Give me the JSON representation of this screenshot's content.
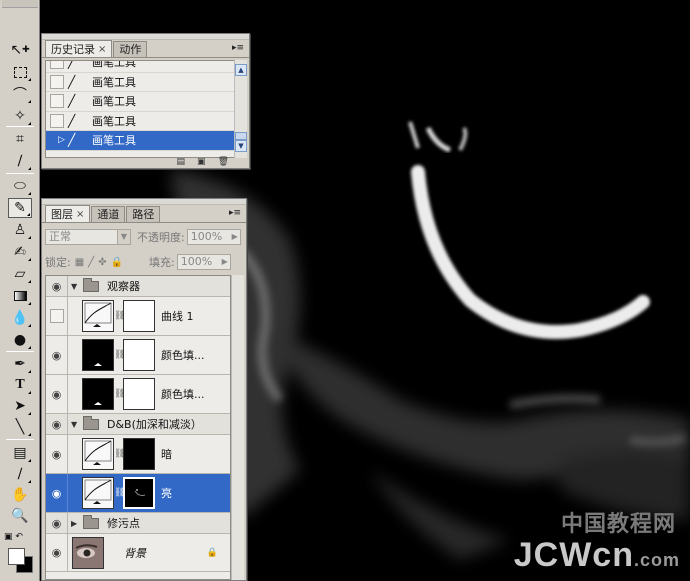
{
  "history_panel": {
    "tabs": [
      {
        "label": "历史记录",
        "active": true,
        "closable": true
      },
      {
        "label": "动作",
        "active": false,
        "closable": false
      }
    ],
    "items": [
      {
        "label": "画笔工具",
        "selected": false
      },
      {
        "label": "画笔工具",
        "selected": false
      },
      {
        "label": "画笔工具",
        "selected": false
      },
      {
        "label": "画笔工具",
        "selected": false
      },
      {
        "label": "画笔工具",
        "selected": true
      }
    ],
    "bottom_icons": [
      "new-document-from-state-icon",
      "snapshot-camera-icon",
      "trash-icon"
    ]
  },
  "layers_panel": {
    "tabs": [
      {
        "label": "图层",
        "active": true,
        "closable": true
      },
      {
        "label": "通道",
        "active": false,
        "closable": false
      },
      {
        "label": "路径",
        "active": false,
        "closable": false
      }
    ],
    "blend_mode": "正常",
    "opacity_label": "不透明度:",
    "opacity_value": "100%",
    "lock_label": "锁定:",
    "fill_label": "填充:",
    "fill_value": "100%",
    "rows": [
      {
        "kind": "group",
        "name": "观察器",
        "expanded": true,
        "visible": true
      },
      {
        "kind": "layer",
        "name": "曲线 1",
        "thumb": "curves",
        "mask": "white",
        "visible": false,
        "indent": true
      },
      {
        "kind": "layer",
        "name": "颜色填...",
        "thumb": "black",
        "mask": "white",
        "visible": true,
        "indent": true
      },
      {
        "kind": "layer",
        "name": "颜色填...",
        "thumb": "black",
        "mask": "white",
        "visible": true,
        "indent": true
      },
      {
        "kind": "group",
        "name": "D&B(加深和减淡）",
        "expanded": true,
        "visible": true
      },
      {
        "kind": "layer",
        "name": "暗",
        "thumb": "curves",
        "mask": "black",
        "visible": true,
        "indent": true
      },
      {
        "kind": "layer",
        "name": "亮",
        "thumb": "curves",
        "mask": "black-detail",
        "visible": true,
        "indent": true,
        "selected": true
      },
      {
        "kind": "group",
        "name": "修污点",
        "expanded": false,
        "visible": true
      },
      {
        "kind": "layer",
        "name": "背景",
        "thumb": "photo",
        "visible": true,
        "indent": false,
        "locked": true,
        "italic": true
      }
    ]
  },
  "toolbar": {
    "tools": [
      "move-tool-icon",
      "marquee-tool-icon",
      "lasso-tool-icon",
      "magic-wand-icon",
      "crop-tool-icon",
      "eyedropper-slice-icon",
      "healing-brush-icon",
      "brush-tool-icon",
      "clone-stamp-icon",
      "history-brush-icon",
      "eraser-icon",
      "gradient-icon",
      "blur-icon",
      "dodge-icon",
      "pen-tool-icon",
      "type-tool-icon",
      "path-select-icon",
      "line-tool-icon",
      "notes-icon",
      "eyedropper-icon",
      "hand-tool-icon",
      "zoom-tool-icon"
    ],
    "active_tool": "brush-tool-icon"
  },
  "watermark": {
    "cn": "中国教程网",
    "en": "JCWcn",
    "tld": ".com"
  }
}
